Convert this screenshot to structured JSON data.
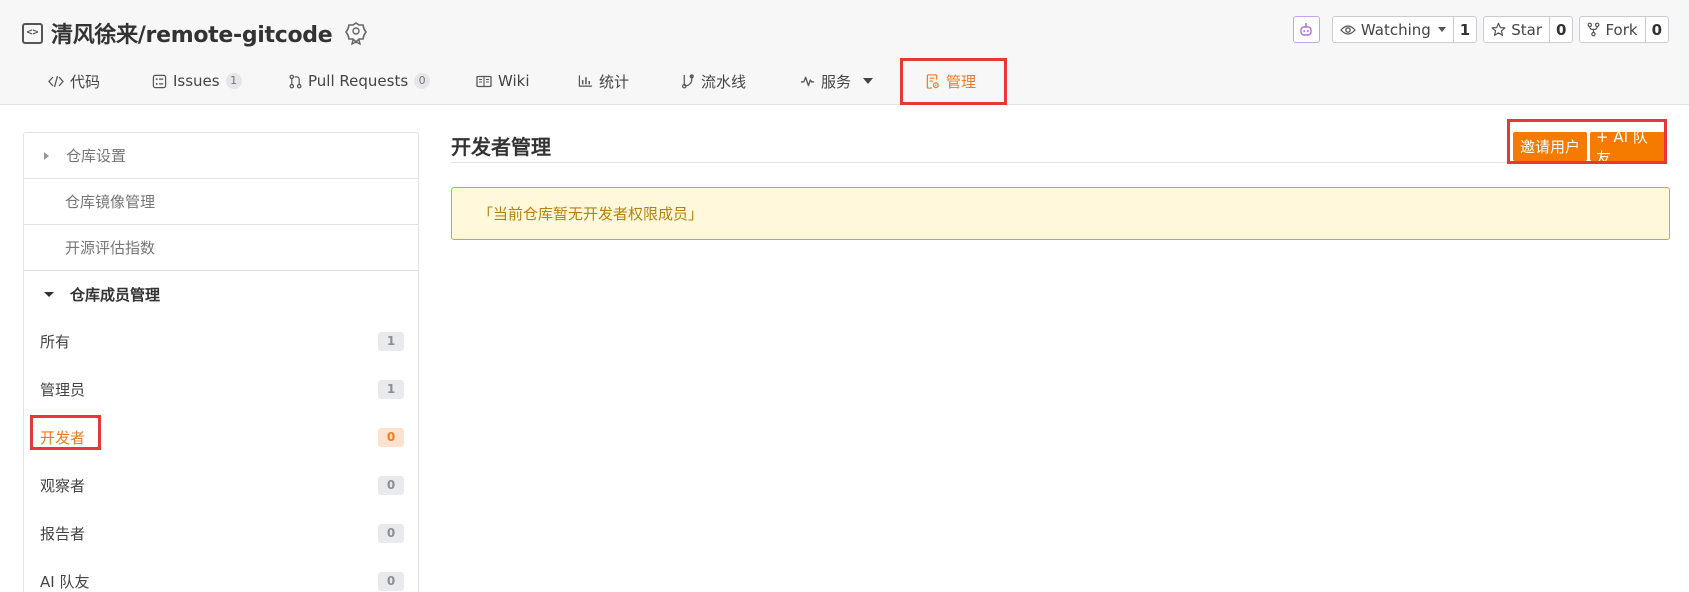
{
  "repo": {
    "owner": "清风徐来",
    "name": "remote-gitcode",
    "full_name": "清风徐来/remote-gitcode"
  },
  "header_actions": {
    "watching_label": "Watching",
    "watching_count": "1",
    "star_label": "Star",
    "star_count": "0",
    "fork_label": "Fork",
    "fork_count": "0"
  },
  "tabs": [
    {
      "label": "代码",
      "icon": "code-icon"
    },
    {
      "label": "Issues",
      "count": "1",
      "icon": "issues-icon"
    },
    {
      "label": "Pull Requests",
      "count": "0",
      "icon": "pull-request-icon"
    },
    {
      "label": "Wiki",
      "icon": "book-icon"
    },
    {
      "label": "统计",
      "icon": "bar-chart-icon"
    },
    {
      "label": "流水线",
      "icon": "pipeline-icon"
    },
    {
      "label": "服务",
      "icon": "pulse-icon"
    },
    {
      "label": "管理",
      "icon": "settings-doc-icon",
      "active": true
    }
  ],
  "sidebar": {
    "groups": [
      {
        "label": "仓库设置"
      },
      {
        "label": "仓库镜像管理"
      },
      {
        "label": "开源评估指数"
      },
      {
        "label": "仓库成员管理"
      }
    ],
    "members": [
      {
        "label": "所有",
        "count": "1"
      },
      {
        "label": "管理员",
        "count": "1"
      },
      {
        "label": "开发者",
        "count": "0",
        "active": true
      },
      {
        "label": "观察者",
        "count": "0"
      },
      {
        "label": "报告者",
        "count": "0"
      },
      {
        "label": "AI 队友",
        "count": "0"
      }
    ]
  },
  "main": {
    "title": "开发者管理",
    "invite_button": "邀请用户",
    "ai_button": "+ AI 队友",
    "notice": "「当前仓库暂无开发者权限成员」"
  },
  "colors": {
    "accent": "#f57a00",
    "highlight": "#e53935",
    "notice_bg": "#fff8db",
    "notice_text": "#b5820f"
  }
}
